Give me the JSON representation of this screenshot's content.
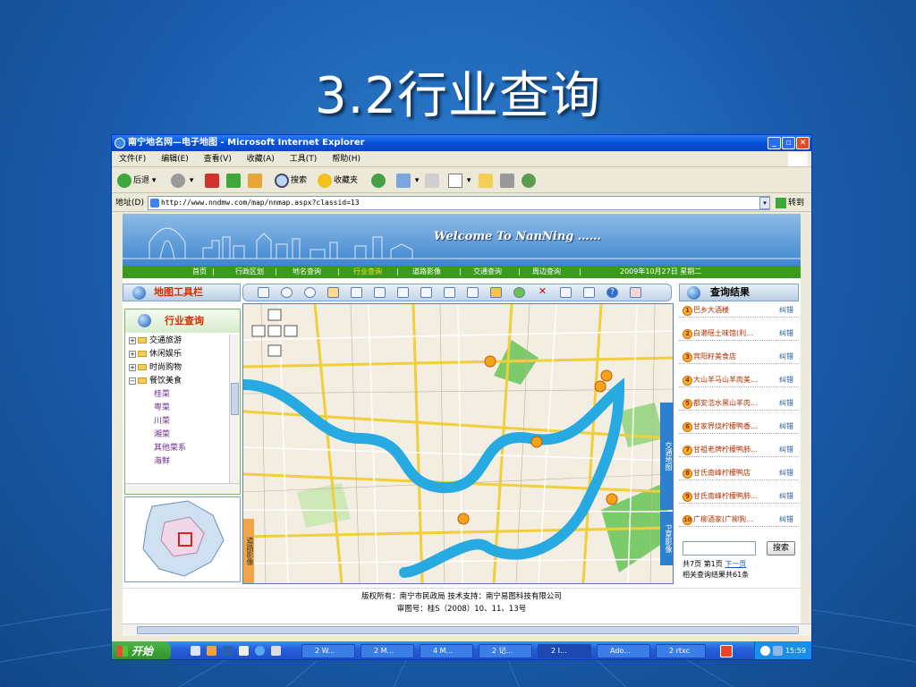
{
  "slide": {
    "title": "3.2行业查询"
  },
  "window": {
    "title": "南宁地名网—电子地图 - Microsoft Internet Explorer"
  },
  "menu": [
    "文件(F)",
    "编辑(E)",
    "查看(V)",
    "收藏(A)",
    "工具(T)",
    "帮助(H)"
  ],
  "toolbar": {
    "back": "后退",
    "search": "搜索",
    "favorites": "收藏夹"
  },
  "address": {
    "label": "地址(D)",
    "url": "http://www.nndmw.com/map/nnmap.aspx?classid=13",
    "go": "转到"
  },
  "banner": {
    "text": "Welcome  To  NanNing ……"
  },
  "nav": {
    "items": [
      "首页",
      "行政区划",
      "地名查询",
      "行业查询",
      "道路影像",
      "交通查询",
      "周边查询"
    ],
    "active": 3,
    "date": "2009年10月27日 星期二"
  },
  "tools": {
    "title": "地图工具栏"
  },
  "industry": {
    "title": "行业查询",
    "categories": [
      "交通旅游",
      "休闲娱乐",
      "时尚购物",
      "餐饮美食"
    ],
    "subcategories": [
      "桂菜",
      "粤菜",
      "川菜",
      "湘菜",
      "其他菜系",
      "海鲜"
    ]
  },
  "map": {
    "side_tabs": [
      "交通地图",
      "卫星影像",
      "道路影像"
    ]
  },
  "results": {
    "title": "查询结果",
    "items": [
      {
        "num": "1",
        "name": "巴乡大酒楼",
        "link": "纠错"
      },
      {
        "num": "2",
        "name": "白濑瑶土味馆(利…",
        "link": "纠错"
      },
      {
        "num": "3",
        "name": "宾阳籽美食店",
        "link": "纠错"
      },
      {
        "num": "4",
        "name": "大山羊马山羊肉美…",
        "link": "纠错"
      },
      {
        "num": "5",
        "name": "都安浩水黑山羊肉…",
        "link": "纠错"
      },
      {
        "num": "6",
        "name": "甘家界烧柠檬鸭香…",
        "link": "纠错"
      },
      {
        "num": "7",
        "name": "甘祖老牌柠檬鸭肺…",
        "link": "纠错"
      },
      {
        "num": "8",
        "name": "甘氏南峰柠檬鸭店",
        "link": "纠错"
      },
      {
        "num": "9",
        "name": "甘氏南峰柠檬鸭肺…",
        "link": "纠错"
      },
      {
        "num": "10",
        "name": "广柳酒家(广柳狗…",
        "link": "纠错"
      }
    ],
    "search_button": "搜索",
    "pager_left": "共7页  第1页",
    "pager_next": "下一页",
    "total": "相关查询结果共61条"
  },
  "footer": {
    "line1": "版权所有：南宁市民政局    技术支持：南宁易图科技有限公司",
    "line2": "审图号：桂S（2008）10、11、13号"
  },
  "taskbar": {
    "start": "开始",
    "tasks": [
      "2 W...",
      "2 M...",
      "4 M...",
      "2 记...",
      "2 I...",
      "Ado...",
      "2 rtxc"
    ],
    "active_task": 4,
    "clock": "15:59"
  },
  "colors": {
    "slide_bg": "#1a5aa8",
    "nav_green": "#3a9a1e",
    "accent_orange": "#cc3300",
    "river": "#27a9e1"
  }
}
